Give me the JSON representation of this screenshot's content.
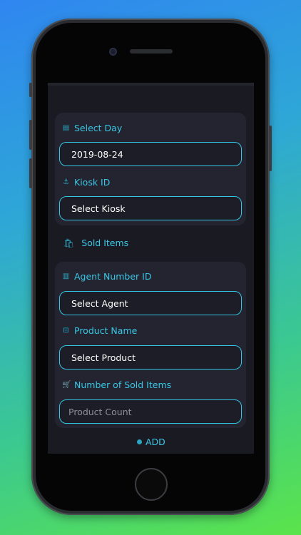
{
  "form": {
    "select_day": {
      "label": "Select Day",
      "value": "2019-08-24"
    },
    "kiosk": {
      "label": "Kiosk ID",
      "value": "Select Kiosk"
    },
    "section_title": "Sold Items",
    "agent": {
      "label": "Agent Number ID",
      "value": "Select Agent"
    },
    "product": {
      "label": "Product Name",
      "value": "Select Product"
    },
    "count": {
      "label": "Number of Sold Items",
      "placeholder": "Product Count"
    },
    "add_label": "ADD"
  },
  "icons": {
    "calendar": "calendar-icon",
    "kiosk": "anchor-icon",
    "sold": "basket-icon",
    "agent": "badge-icon",
    "product": "tag-icon",
    "count": "cart-icon"
  },
  "colors": {
    "accent": "#38c7e6",
    "screen_bg": "#1a1b22",
    "card_bg": "#23242f"
  }
}
